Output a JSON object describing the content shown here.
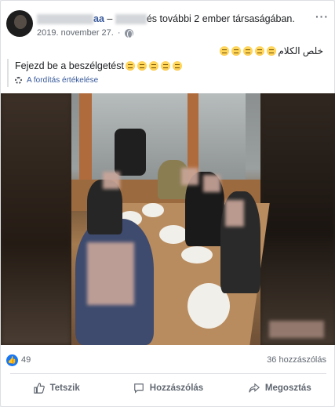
{
  "post": {
    "author_suffix": "aa",
    "dash": "–",
    "with_text": "és további 2 ember társaságában.",
    "date": "2019. november 27.",
    "separator": "·",
    "more_icon": "more-dots-icon",
    "original_text": "خلص الكلام",
    "original_emoji_count": 5,
    "translated_text": "Fejezd be a beszélgetést",
    "translated_emoji_count": 5,
    "rate_translation": "A fordítás értékelése"
  },
  "stats": {
    "likes": "49",
    "comments": "36 hozzászólás"
  },
  "actions": {
    "like": "Tetszik",
    "comment": "Hozzászólás",
    "share": "Megosztás"
  },
  "colors": {
    "link": "#365899",
    "like_blue": "#1877f2",
    "muted": "#606770"
  }
}
